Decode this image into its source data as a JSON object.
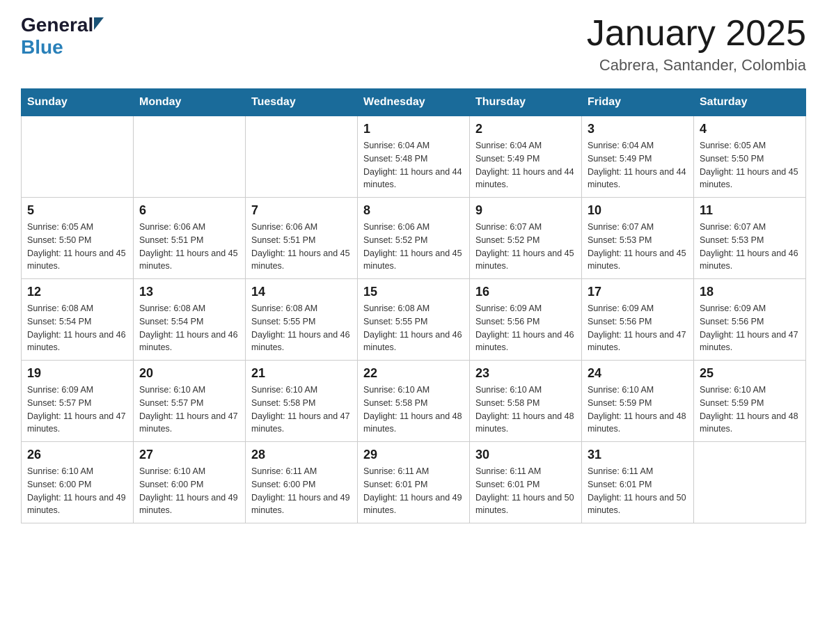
{
  "logo": {
    "general": "General",
    "blue": "Blue"
  },
  "title": "January 2025",
  "location": "Cabrera, Santander, Colombia",
  "headers": [
    "Sunday",
    "Monday",
    "Tuesday",
    "Wednesday",
    "Thursday",
    "Friday",
    "Saturday"
  ],
  "weeks": [
    [
      {
        "day": "",
        "info": ""
      },
      {
        "day": "",
        "info": ""
      },
      {
        "day": "",
        "info": ""
      },
      {
        "day": "1",
        "info": "Sunrise: 6:04 AM\nSunset: 5:48 PM\nDaylight: 11 hours and 44 minutes."
      },
      {
        "day": "2",
        "info": "Sunrise: 6:04 AM\nSunset: 5:49 PM\nDaylight: 11 hours and 44 minutes."
      },
      {
        "day": "3",
        "info": "Sunrise: 6:04 AM\nSunset: 5:49 PM\nDaylight: 11 hours and 44 minutes."
      },
      {
        "day": "4",
        "info": "Sunrise: 6:05 AM\nSunset: 5:50 PM\nDaylight: 11 hours and 45 minutes."
      }
    ],
    [
      {
        "day": "5",
        "info": "Sunrise: 6:05 AM\nSunset: 5:50 PM\nDaylight: 11 hours and 45 minutes."
      },
      {
        "day": "6",
        "info": "Sunrise: 6:06 AM\nSunset: 5:51 PM\nDaylight: 11 hours and 45 minutes."
      },
      {
        "day": "7",
        "info": "Sunrise: 6:06 AM\nSunset: 5:51 PM\nDaylight: 11 hours and 45 minutes."
      },
      {
        "day": "8",
        "info": "Sunrise: 6:06 AM\nSunset: 5:52 PM\nDaylight: 11 hours and 45 minutes."
      },
      {
        "day": "9",
        "info": "Sunrise: 6:07 AM\nSunset: 5:52 PM\nDaylight: 11 hours and 45 minutes."
      },
      {
        "day": "10",
        "info": "Sunrise: 6:07 AM\nSunset: 5:53 PM\nDaylight: 11 hours and 45 minutes."
      },
      {
        "day": "11",
        "info": "Sunrise: 6:07 AM\nSunset: 5:53 PM\nDaylight: 11 hours and 46 minutes."
      }
    ],
    [
      {
        "day": "12",
        "info": "Sunrise: 6:08 AM\nSunset: 5:54 PM\nDaylight: 11 hours and 46 minutes."
      },
      {
        "day": "13",
        "info": "Sunrise: 6:08 AM\nSunset: 5:54 PM\nDaylight: 11 hours and 46 minutes."
      },
      {
        "day": "14",
        "info": "Sunrise: 6:08 AM\nSunset: 5:55 PM\nDaylight: 11 hours and 46 minutes."
      },
      {
        "day": "15",
        "info": "Sunrise: 6:08 AM\nSunset: 5:55 PM\nDaylight: 11 hours and 46 minutes."
      },
      {
        "day": "16",
        "info": "Sunrise: 6:09 AM\nSunset: 5:56 PM\nDaylight: 11 hours and 46 minutes."
      },
      {
        "day": "17",
        "info": "Sunrise: 6:09 AM\nSunset: 5:56 PM\nDaylight: 11 hours and 47 minutes."
      },
      {
        "day": "18",
        "info": "Sunrise: 6:09 AM\nSunset: 5:56 PM\nDaylight: 11 hours and 47 minutes."
      }
    ],
    [
      {
        "day": "19",
        "info": "Sunrise: 6:09 AM\nSunset: 5:57 PM\nDaylight: 11 hours and 47 minutes."
      },
      {
        "day": "20",
        "info": "Sunrise: 6:10 AM\nSunset: 5:57 PM\nDaylight: 11 hours and 47 minutes."
      },
      {
        "day": "21",
        "info": "Sunrise: 6:10 AM\nSunset: 5:58 PM\nDaylight: 11 hours and 47 minutes."
      },
      {
        "day": "22",
        "info": "Sunrise: 6:10 AM\nSunset: 5:58 PM\nDaylight: 11 hours and 48 minutes."
      },
      {
        "day": "23",
        "info": "Sunrise: 6:10 AM\nSunset: 5:58 PM\nDaylight: 11 hours and 48 minutes."
      },
      {
        "day": "24",
        "info": "Sunrise: 6:10 AM\nSunset: 5:59 PM\nDaylight: 11 hours and 48 minutes."
      },
      {
        "day": "25",
        "info": "Sunrise: 6:10 AM\nSunset: 5:59 PM\nDaylight: 11 hours and 48 minutes."
      }
    ],
    [
      {
        "day": "26",
        "info": "Sunrise: 6:10 AM\nSunset: 6:00 PM\nDaylight: 11 hours and 49 minutes."
      },
      {
        "day": "27",
        "info": "Sunrise: 6:10 AM\nSunset: 6:00 PM\nDaylight: 11 hours and 49 minutes."
      },
      {
        "day": "28",
        "info": "Sunrise: 6:11 AM\nSunset: 6:00 PM\nDaylight: 11 hours and 49 minutes."
      },
      {
        "day": "29",
        "info": "Sunrise: 6:11 AM\nSunset: 6:01 PM\nDaylight: 11 hours and 49 minutes."
      },
      {
        "day": "30",
        "info": "Sunrise: 6:11 AM\nSunset: 6:01 PM\nDaylight: 11 hours and 50 minutes."
      },
      {
        "day": "31",
        "info": "Sunrise: 6:11 AM\nSunset: 6:01 PM\nDaylight: 11 hours and 50 minutes."
      },
      {
        "day": "",
        "info": ""
      }
    ]
  ]
}
